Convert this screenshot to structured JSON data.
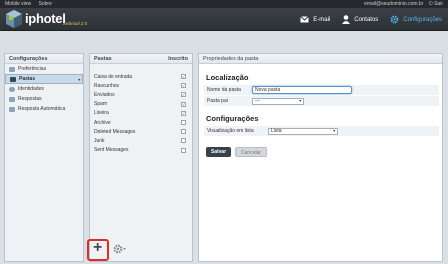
{
  "topbar": {
    "mobile_view": "Mobile view",
    "about": "Sobre",
    "email": "email@seudominio.com.br",
    "logout": "Sair"
  },
  "header": {
    "brand": "iphotel",
    "brand_sub": "webmail 2.0",
    "nav": [
      {
        "label": "E-mail",
        "icon": "envelope-icon"
      },
      {
        "label": "Contatos",
        "icon": "person-icon"
      },
      {
        "label": "Configurações",
        "icon": "gear-icon",
        "active": true
      }
    ]
  },
  "settings_panel": {
    "title": "Configurações",
    "items": [
      {
        "label": "Preferências",
        "selected": false
      },
      {
        "label": "Pastas",
        "selected": true
      },
      {
        "label": "Identidades",
        "selected": false
      },
      {
        "label": "Respostas",
        "selected": false
      },
      {
        "label": "Resposta Automática",
        "selected": false
      }
    ]
  },
  "folders_panel": {
    "title": "Pastas",
    "subscribed_header": "Inscrito",
    "folders": [
      {
        "name": "Caixa de entrada",
        "subscribed": true
      },
      {
        "name": "Rascunhos",
        "subscribed": true
      },
      {
        "name": "Enviados",
        "subscribed": true
      },
      {
        "name": "Spam",
        "subscribed": true
      },
      {
        "name": "Lixeira",
        "subscribed": true
      },
      {
        "name": "Archive",
        "subscribed": false
      },
      {
        "name": "Deleted Messages",
        "subscribed": false
      },
      {
        "name": "Junk",
        "subscribed": false
      },
      {
        "name": "Sent Messages",
        "subscribed": false
      }
    ],
    "add_symbol": "+"
  },
  "properties": {
    "title": "Propriedades da pasta",
    "location_title": "Localização",
    "folder_name_label": "Nome da pasta",
    "folder_name_value": "Nova pasta",
    "parent_label": "Pasta pai",
    "parent_value": "---",
    "settings_title": "Configurações",
    "list_view_label": "Visualização em lista",
    "list_view_value": "Lista",
    "save": "Salvar",
    "cancel": "Cancelar"
  },
  "colors": {
    "accent": "#55b6ea",
    "highlight_box": "#e22a27",
    "header_bg": "#2c3136"
  }
}
